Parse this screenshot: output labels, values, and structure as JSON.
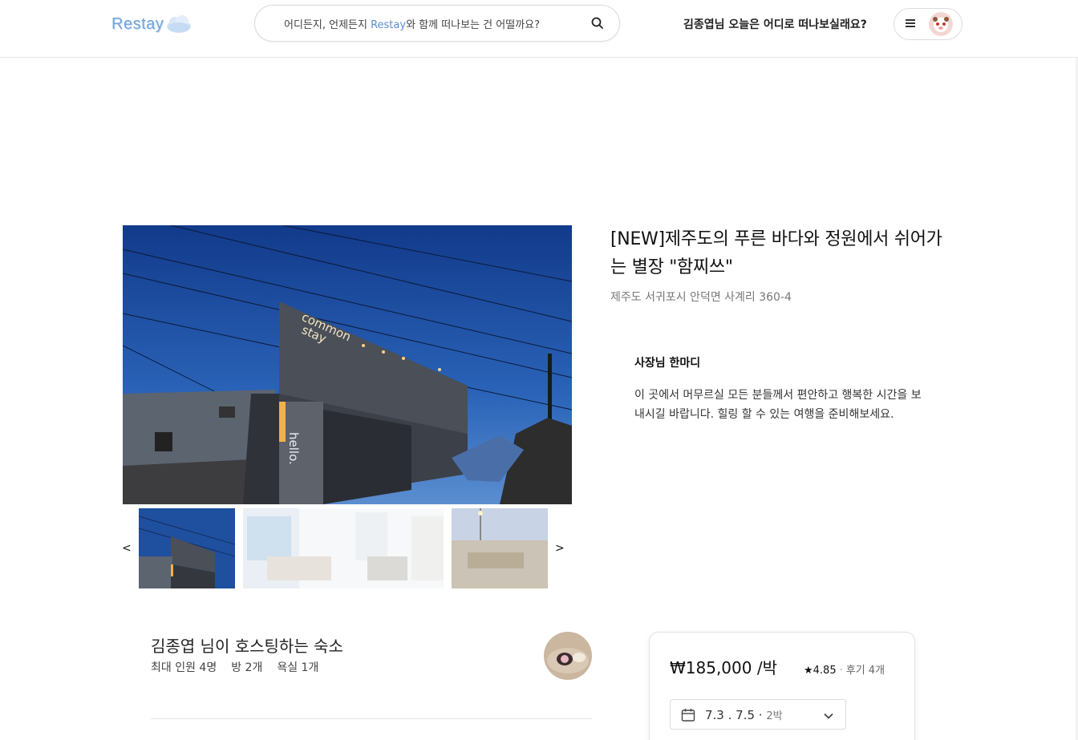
{
  "header": {
    "logo_text": "Restay",
    "search": {
      "prefix": "어디든지, 언제든지 ",
      "brand": "Restay",
      "suffix": "와 함께 떠나보는 건 어떨까요?"
    },
    "greeting": "김종엽님 오늘은 어디로 떠나보실래요?",
    "menu_icon": "hamburger-icon",
    "avatar_icon": "user-avatar"
  },
  "gallery": {
    "prev": "<",
    "next": ">",
    "thumbnails": [
      "exterior-night",
      "interior-living",
      "rooftop-terrace"
    ]
  },
  "listing": {
    "title": "[NEW]제주도의 푸른 바다와 정원에서 쉬어가는 별장 \"함찌쓰\"",
    "address": "제주도 서귀포시 안덕면 사계리 360-4",
    "owner_title": "사장님 한마디",
    "owner_message": "이 곳에서 머무르실 모든 분들께서 편안하고 행복한 시간을 보내시길 바랍니다. 힐링 할 수 있는 여행을 준비해보세요."
  },
  "host": {
    "title": "김종엽 님이 호스팅하는 숙소",
    "max_guests": "최대 인원 4명",
    "rooms": "방 2개",
    "baths": "욕실 1개"
  },
  "booking": {
    "price": "₩185,000 /박",
    "rating": "★4.85",
    "dot": "·",
    "reviews": "후기 4개",
    "dates": "7.3 . 7.5",
    "nights": "2박"
  },
  "photo_signage": {
    "sign1": "common",
    "sign2": "stay",
    "sign3": "hello."
  },
  "colors": {
    "brand": "#6fa4dc",
    "sky": "#1f4a9c"
  }
}
